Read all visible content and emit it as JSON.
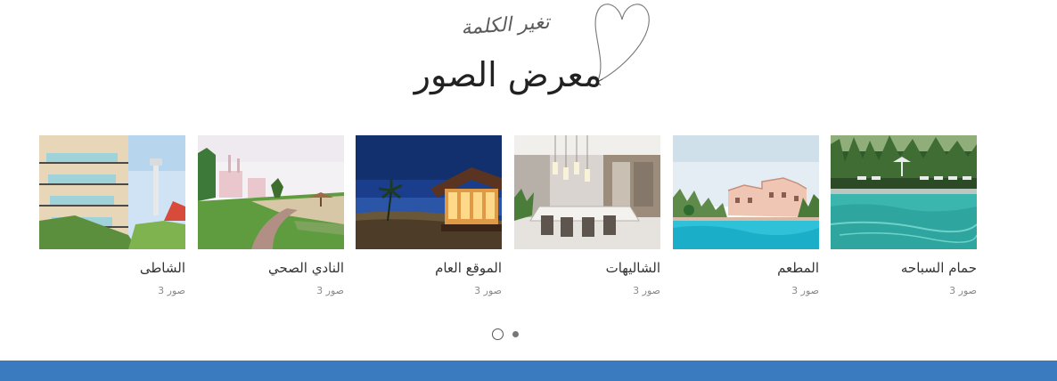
{
  "header": {
    "subtitle": "تغير الكلمة",
    "title": "معرض الصور"
  },
  "gallery": {
    "items": [
      {
        "title": "حمام السباحه",
        "count": "صور 3",
        "image": "swimming-pool-photo"
      },
      {
        "title": "المطعم",
        "count": "صور 3",
        "image": "restaurant-pool-photo"
      },
      {
        "title": "الشاليهات",
        "count": "صور 3",
        "image": "chalets-interior-photo"
      },
      {
        "title": "الموقع العام",
        "count": "صور 3",
        "image": "site-night-photo"
      },
      {
        "title": "النادي الصحي",
        "count": "صور 3",
        "image": "health-club-photo"
      },
      {
        "title": "الشاطى",
        "count": "صور 3",
        "image": "beach-chalets-photo"
      }
    ]
  },
  "pagination": {
    "pages": 2,
    "active": 1
  },
  "colors": {
    "footer": "#3a7bbf",
    "title_text": "#222222",
    "count_text": "#8a8a8a"
  }
}
